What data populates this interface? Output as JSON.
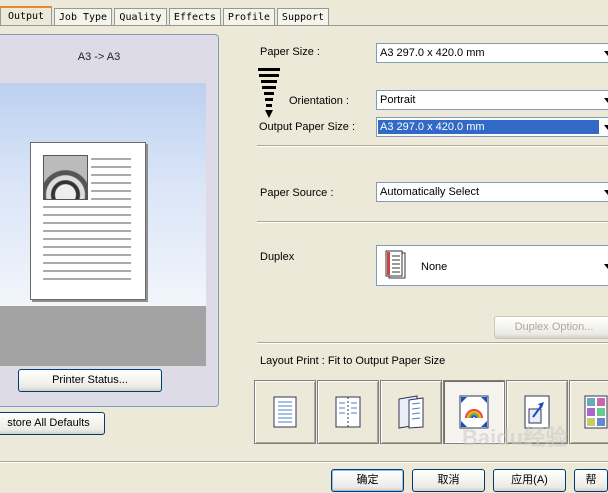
{
  "tabs": [
    "Output",
    "Job Type",
    "Quality",
    "Effects",
    "Profile",
    "Support"
  ],
  "preview": {
    "title": "A3 -> A3",
    "printer_status_label": "Printer Status...",
    "restore_defaults_label": "store All Defaults"
  },
  "settings": {
    "paper_size_label": "Paper Size :",
    "paper_size_value": "A3   297.0 x 420.0 mm",
    "orientation_label": "Orientation :",
    "orientation_value": "Portrait",
    "output_paper_size_label": "Output Paper Size :",
    "output_paper_size_value": "A3   297.0 x 420.0 mm",
    "paper_source_label": "Paper Source :",
    "paper_source_value": "Automatically Select",
    "duplex_label": "Duplex",
    "duplex_value": "None",
    "duplex_option_label": "Duplex Option...",
    "layout_print_label": "Layout Print :  Fit to Output Paper Size"
  },
  "layout_options": [
    "standard-layout-icon",
    "booklet-layout-icon",
    "poster-layout-icon",
    "fit-to-page-icon",
    "scaling-icon",
    "multi-page-icon"
  ],
  "dialog_buttons": {
    "ok": "确定",
    "cancel": "取消",
    "apply": "应用(A)",
    "help": "帮"
  },
  "watermark": "Baidu经验",
  "colors": {
    "selection": "#316ac5",
    "tab_accent": "#e68b2c",
    "dialog_bg": "#ece9d8"
  }
}
